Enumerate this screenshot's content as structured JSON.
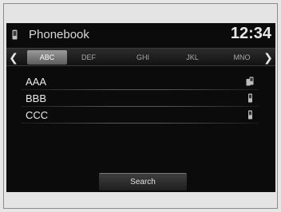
{
  "header": {
    "title": "Phonebook",
    "clock": "12:34",
    "icon": "phone-icon"
  },
  "tabs": [
    {
      "label": "ABC",
      "active": true
    },
    {
      "label": "DEF",
      "active": false
    },
    {
      "label": "GHI",
      "active": false
    },
    {
      "label": "JKL",
      "active": false
    },
    {
      "label": "MNO",
      "active": false
    }
  ],
  "nav": {
    "prev_icon": "chevron-left-icon",
    "next_icon": "chevron-right-icon"
  },
  "contacts": [
    {
      "name": "AAA",
      "icon": "multiple-phones-icon"
    },
    {
      "name": "BBB",
      "icon": "mobile-phone-icon"
    },
    {
      "name": "CCC",
      "icon": "mobile-phone-icon"
    }
  ],
  "search_label": "Search",
  "colors": {
    "screen_background": "#0b0b0b",
    "active_tab": "#8a8a8a",
    "text": "#ececec"
  }
}
